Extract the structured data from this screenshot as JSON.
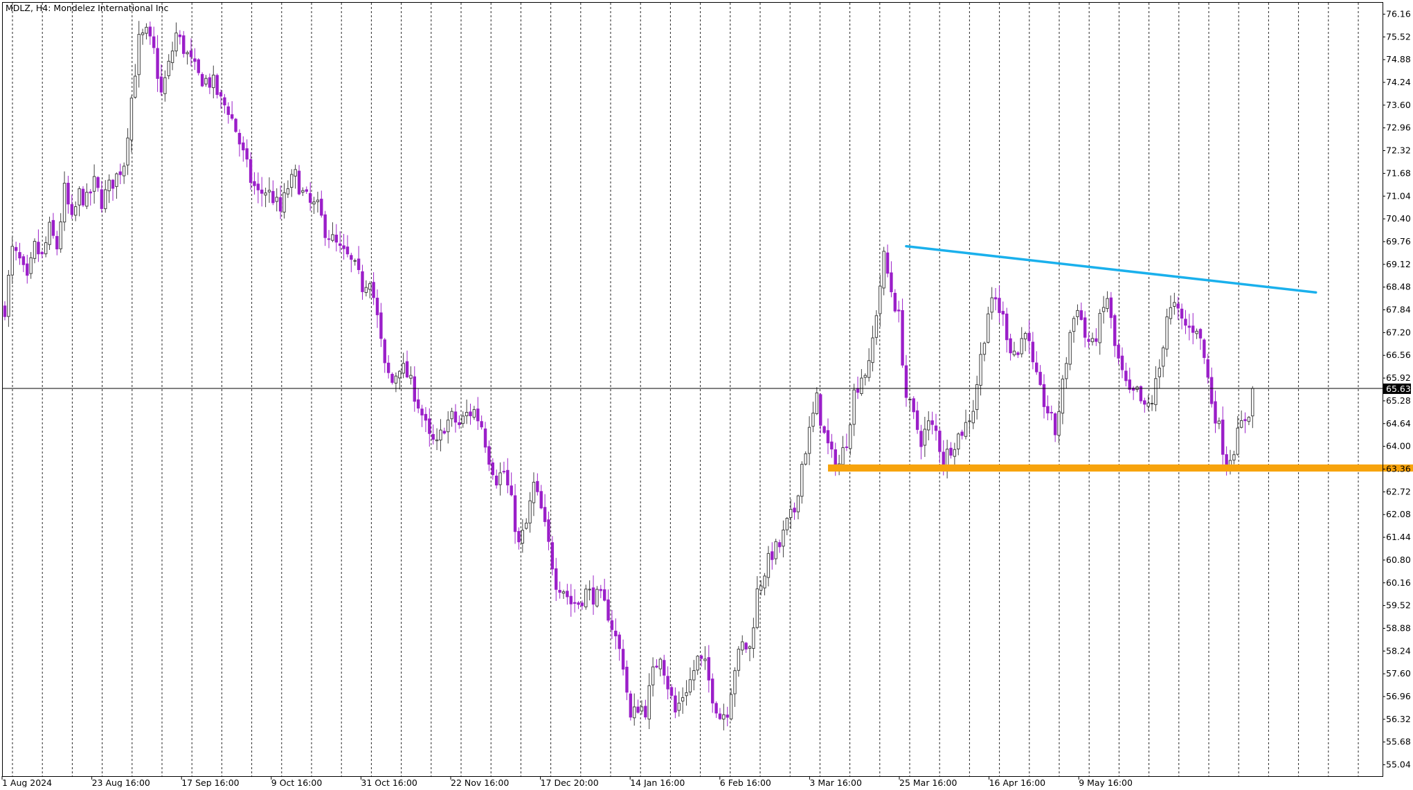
{
  "chart_data": {
    "type": "candlestick",
    "title": "MDLZ, H4:  Mondelez International Inc",
    "ylim": [
      54.72,
      76.48
    ],
    "y_ticks": [
      "76.16",
      "75.52",
      "74.88",
      "74.24",
      "73.60",
      "72.96",
      "72.32",
      "71.68",
      "71.04",
      "70.40",
      "69.76",
      "69.12",
      "68.48",
      "67.84",
      "67.20",
      "66.56",
      "65.92",
      "65.28",
      "64.64",
      "64.00",
      "63.36",
      "62.72",
      "62.08",
      "61.44",
      "60.80",
      "60.16",
      "59.52",
      "58.88",
      "58.24",
      "57.60",
      "56.96",
      "56.32",
      "55.68",
      "55.04"
    ],
    "x_ticks": [
      "1 Aug 2024",
      "23 Aug 16:00",
      "17 Sep 16:00",
      "9 Oct 16:00",
      "31 Oct 16:00",
      "22 Nov 16:00",
      "17 Dec 20:00",
      "14 Jan 16:00",
      "6 Feb 16:00",
      "3 Mar 16:00",
      "25 Mar 16:00",
      "16 Apr 16:00",
      "9 May 16:00"
    ],
    "current_price": "65.63",
    "grid": "vertical dashed",
    "colors": {
      "bull_candle": "#404040",
      "bear_candle": "#9b1fc9",
      "trendline": "#1ab0ec",
      "support_zone": "#f7a30c",
      "price_line": "#000000"
    },
    "price_path": [
      [
        0,
        67.9
      ],
      [
        2,
        69.5
      ],
      [
        4,
        69.2
      ],
      [
        6,
        68.6
      ],
      [
        8,
        69.6
      ],
      [
        10,
        69.3
      ],
      [
        12,
        70.1
      ],
      [
        14,
        69.6
      ],
      [
        16,
        71.2
      ],
      [
        18,
        70.3
      ],
      [
        20,
        71.1
      ],
      [
        22,
        70.9
      ],
      [
        24,
        71.4
      ],
      [
        26,
        70.9
      ],
      [
        28,
        71.3
      ],
      [
        30,
        71.6
      ],
      [
        32,
        72.0
      ],
      [
        34,
        73.8
      ],
      [
        36,
        75.4
      ],
      [
        38,
        75.6
      ],
      [
        40,
        75.1
      ],
      [
        42,
        73.9
      ],
      [
        44,
        74.7
      ],
      [
        46,
        75.6
      ],
      [
        48,
        75.2
      ],
      [
        50,
        74.8
      ],
      [
        52,
        74.4
      ],
      [
        54,
        74.3
      ],
      [
        56,
        74.2
      ],
      [
        58,
        73.7
      ],
      [
        60,
        73.5
      ],
      [
        62,
        72.9
      ],
      [
        64,
        72.2
      ],
      [
        66,
        71.5
      ],
      [
        68,
        71.1
      ],
      [
        70,
        71.2
      ],
      [
        72,
        71.0
      ],
      [
        74,
        70.6
      ],
      [
        76,
        71.3
      ],
      [
        78,
        71.6
      ],
      [
        80,
        71.1
      ],
      [
        82,
        70.8
      ],
      [
        84,
        70.7
      ],
      [
        86,
        70.1
      ],
      [
        88,
        69.8
      ],
      [
        90,
        69.5
      ],
      [
        92,
        69.3
      ],
      [
        94,
        69.0
      ],
      [
        96,
        68.5
      ],
      [
        98,
        68.8
      ],
      [
        100,
        67.6
      ],
      [
        102,
        66.2
      ],
      [
        104,
        65.8
      ],
      [
        106,
        66.3
      ],
      [
        108,
        66.0
      ],
      [
        110,
        65.5
      ],
      [
        112,
        64.9
      ],
      [
        114,
        64.2
      ],
      [
        116,
        64.0
      ],
      [
        118,
        64.6
      ],
      [
        120,
        64.8
      ],
      [
        122,
        64.6
      ],
      [
        124,
        64.9
      ],
      [
        126,
        65.0
      ],
      [
        128,
        64.6
      ],
      [
        130,
        63.7
      ],
      [
        132,
        63.1
      ],
      [
        134,
        63.3
      ],
      [
        136,
        62.4
      ],
      [
        138,
        61.2
      ],
      [
        140,
        61.8
      ],
      [
        142,
        62.9
      ],
      [
        144,
        62.2
      ],
      [
        146,
        61.2
      ],
      [
        148,
        60.2
      ],
      [
        150,
        60.0
      ],
      [
        152,
        59.6
      ],
      [
        154,
        59.6
      ],
      [
        156,
        59.9
      ],
      [
        158,
        59.8
      ],
      [
        160,
        59.7
      ],
      [
        162,
        59.3
      ],
      [
        164,
        58.6
      ],
      [
        166,
        57.9
      ],
      [
        168,
        56.3
      ],
      [
        170,
        56.7
      ],
      [
        172,
        56.6
      ],
      [
        174,
        57.6
      ],
      [
        176,
        58.2
      ],
      [
        178,
        57.3
      ],
      [
        180,
        56.5
      ],
      [
        182,
        57.0
      ],
      [
        184,
        57.4
      ],
      [
        186,
        58.0
      ],
      [
        188,
        57.8
      ],
      [
        190,
        57.0
      ],
      [
        192,
        56.4
      ],
      [
        194,
        56.6
      ],
      [
        196,
        57.8
      ],
      [
        198,
        58.4
      ],
      [
        200,
        58.3
      ],
      [
        202,
        59.9
      ],
      [
        204,
        60.5
      ],
      [
        206,
        61.0
      ],
      [
        208,
        61.2
      ],
      [
        210,
        61.8
      ],
      [
        212,
        62.2
      ],
      [
        214,
        63.5
      ],
      [
        216,
        64.4
      ],
      [
        218,
        65.3
      ],
      [
        220,
        64.3
      ],
      [
        222,
        63.7
      ],
      [
        224,
        63.5
      ],
      [
        226,
        64.2
      ],
      [
        228,
        65.5
      ],
      [
        230,
        66.0
      ],
      [
        232,
        66.2
      ],
      [
        234,
        67.8
      ],
      [
        236,
        69.3
      ],
      [
        238,
        68.4
      ],
      [
        240,
        67.6
      ],
      [
        242,
        65.4
      ],
      [
        244,
        64.8
      ],
      [
        246,
        64.2
      ],
      [
        248,
        64.6
      ],
      [
        250,
        64.4
      ],
      [
        252,
        63.6
      ],
      [
        254,
        64.0
      ],
      [
        256,
        64.3
      ],
      [
        258,
        64.6
      ],
      [
        260,
        65.1
      ],
      [
        262,
        66.5
      ],
      [
        264,
        67.8
      ],
      [
        266,
        68.1
      ],
      [
        268,
        67.6
      ],
      [
        270,
        66.8
      ],
      [
        272,
        66.6
      ],
      [
        274,
        67.4
      ],
      [
        276,
        66.2
      ],
      [
        278,
        65.5
      ],
      [
        280,
        65.0
      ],
      [
        282,
        64.4
      ],
      [
        284,
        65.7
      ],
      [
        286,
        67.2
      ],
      [
        288,
        68.0
      ],
      [
        290,
        67.1
      ],
      [
        292,
        66.8
      ],
      [
        294,
        67.5
      ],
      [
        296,
        68.2
      ],
      [
        298,
        66.8
      ],
      [
        300,
        66.0
      ],
      [
        302,
        65.4
      ],
      [
        304,
        65.5
      ],
      [
        306,
        65.0
      ],
      [
        308,
        65.3
      ],
      [
        310,
        66.2
      ],
      [
        312,
        67.7
      ],
      [
        314,
        67.9
      ],
      [
        316,
        67.5
      ],
      [
        318,
        67.3
      ],
      [
        320,
        67.4
      ],
      [
        322,
        66.5
      ],
      [
        324,
        65.3
      ],
      [
        326,
        64.5
      ],
      [
        328,
        63.5
      ],
      [
        330,
        64.0
      ],
      [
        332,
        64.6
      ],
      [
        334,
        65.0
      ],
      [
        335,
        65.63
      ]
    ],
    "annotations": [
      {
        "type": "trendline",
        "from": [
          242,
          69.63
        ],
        "to": [
          352,
          68.33
        ]
      },
      {
        "type": "horizontal_zone",
        "from_x": 221,
        "to_x": 386,
        "y_low": 63.29,
        "y_high": 63.49
      }
    ]
  }
}
